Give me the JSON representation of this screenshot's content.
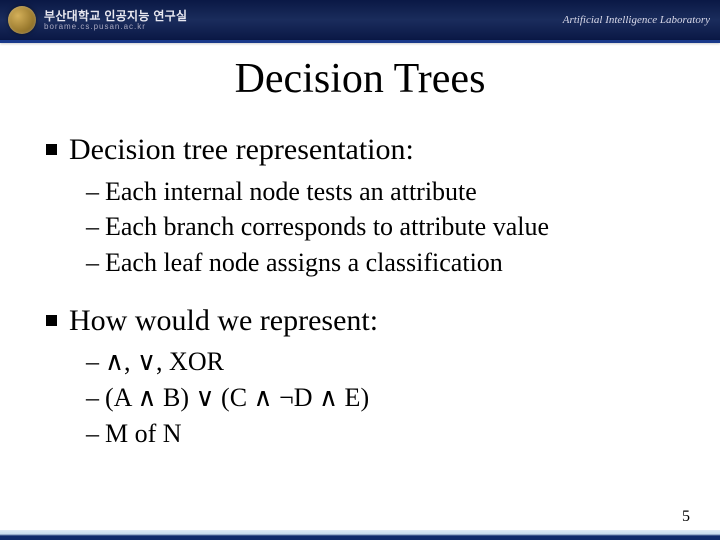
{
  "header": {
    "org_kr": "부산대학교 인공지능 연구실",
    "url": "borame.cs.pusan.ac.kr",
    "lab_en": "Artificial Intelligence Laboratory"
  },
  "title": "Decision Trees",
  "sections": [
    {
      "heading": "Decision tree representation:",
      "items": [
        "Each internal node tests an attribute",
        "Each branch corresponds to attribute value",
        "Each leaf node assigns a classification"
      ]
    },
    {
      "heading": "How would we represent:",
      "items": [
        "∧, ∨, XOR",
        "(A ∧ B) ∨ (C ∧ ¬D ∧ E)",
        "M of N"
      ]
    }
  ],
  "page_number": "5"
}
